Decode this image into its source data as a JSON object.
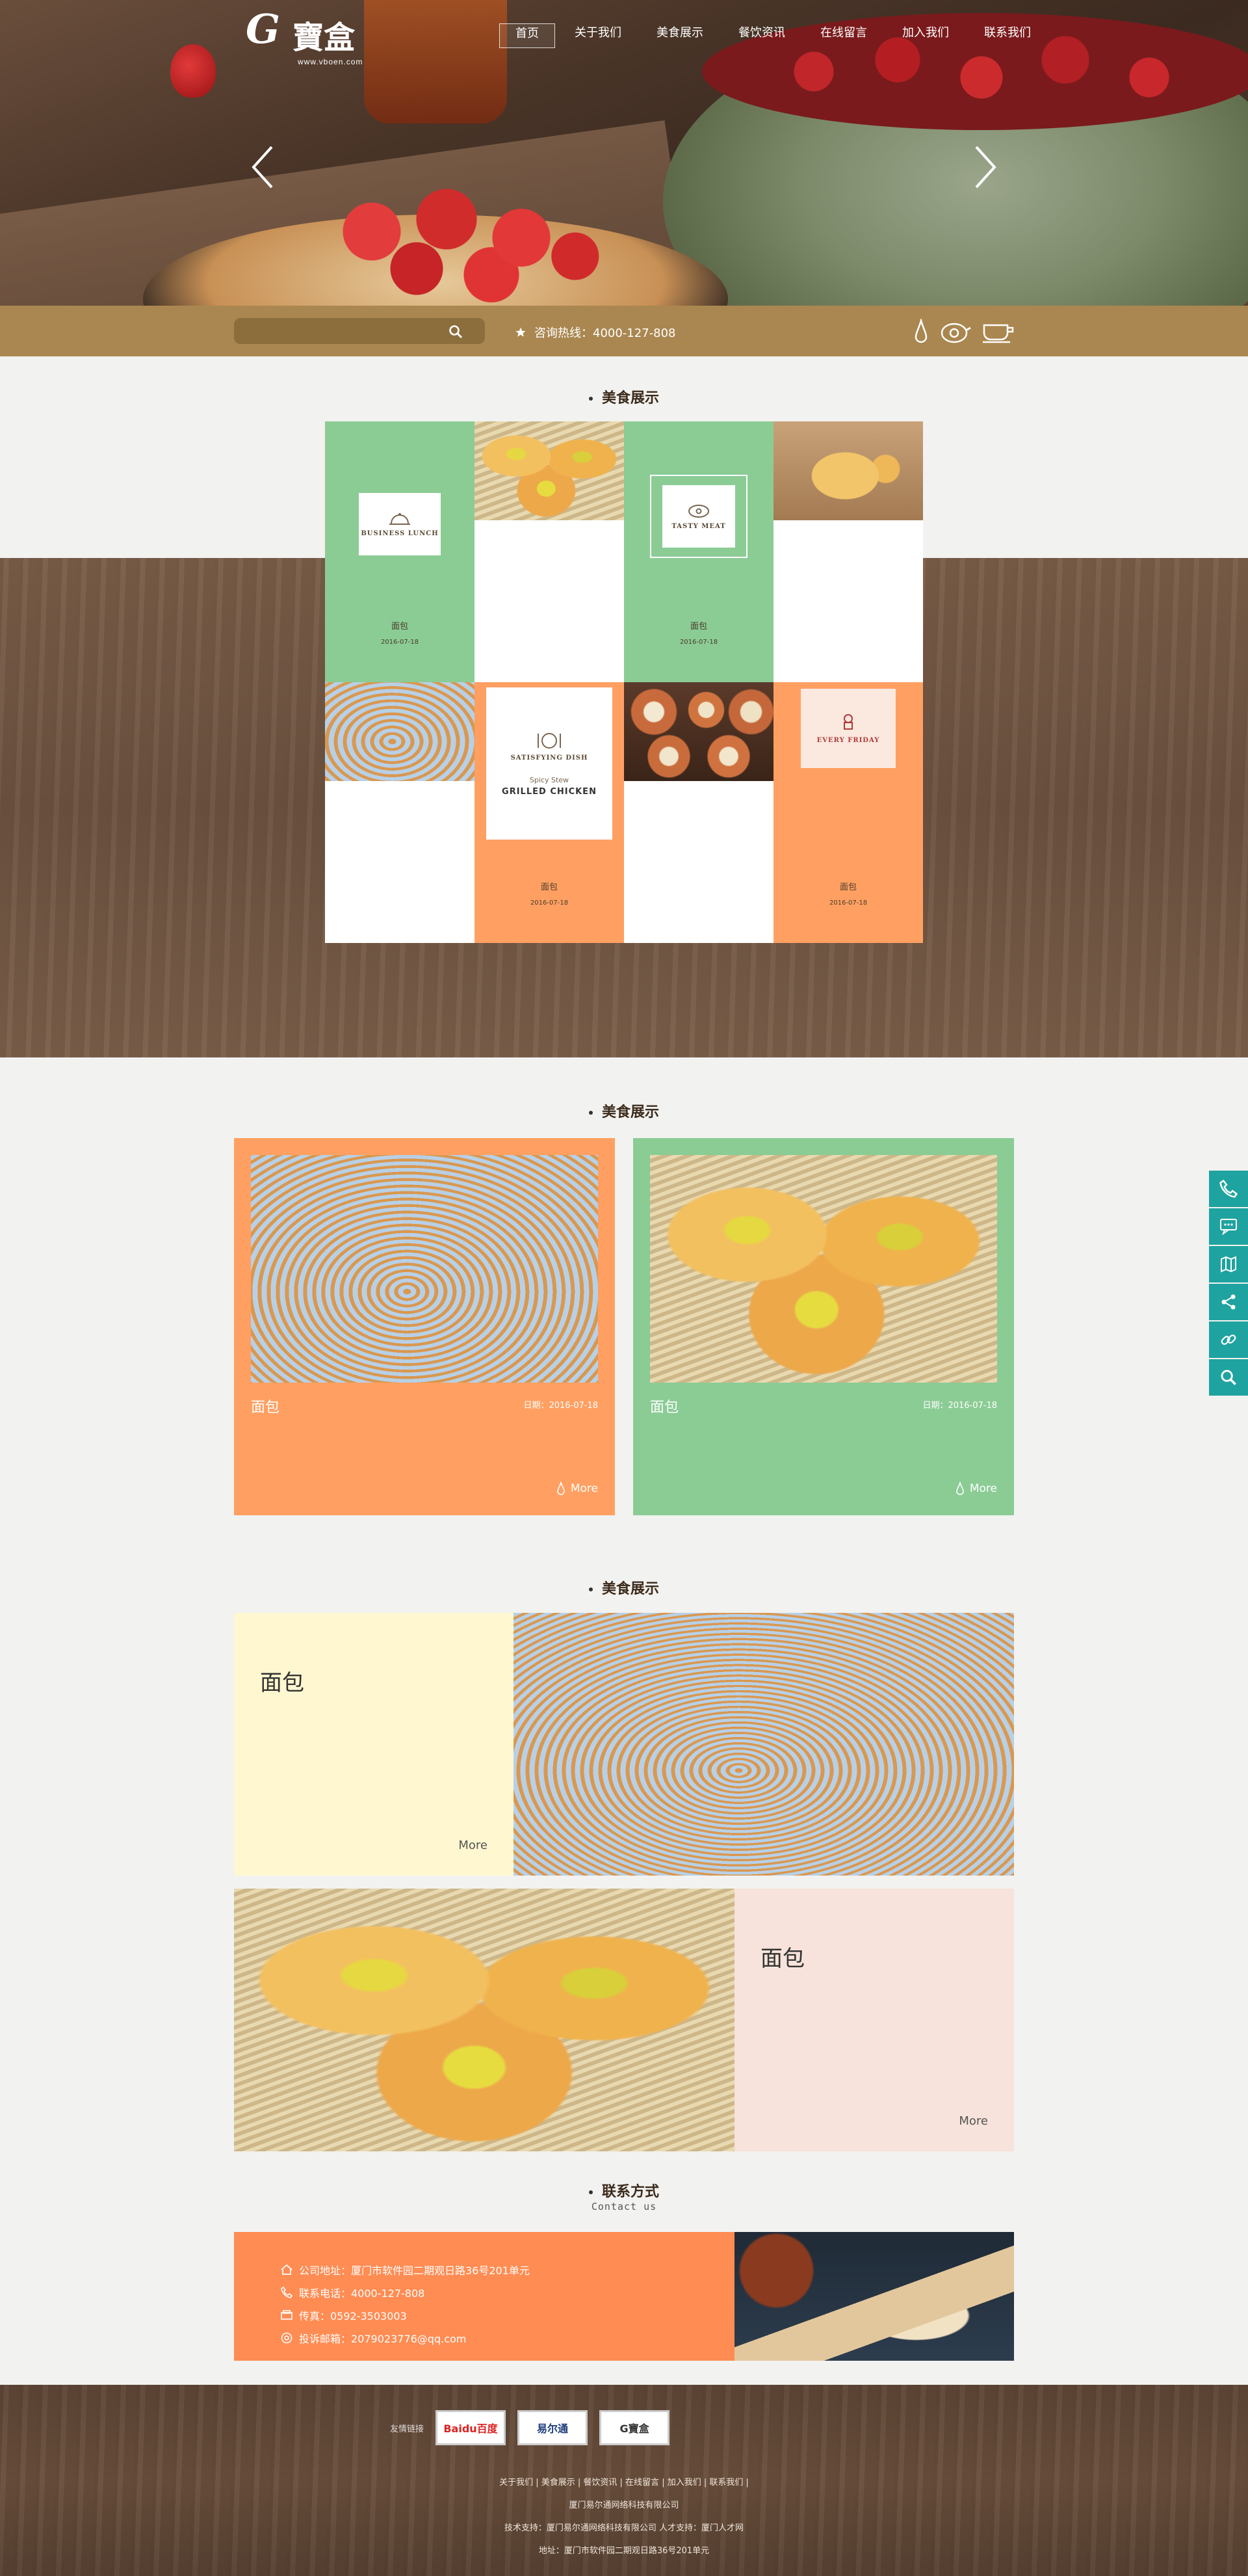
{
  "logo": {
    "g": "G",
    "han": "寶盒",
    "url": "www.vboen.com"
  },
  "nav": [
    {
      "label": "首页",
      "active": true
    },
    {
      "label": "关于我们"
    },
    {
      "label": "美食展示"
    },
    {
      "label": "餐饮资讯"
    },
    {
      "label": "在线留言"
    },
    {
      "label": "加入我们"
    },
    {
      "label": "联系我们"
    }
  ],
  "search": {
    "placeholder": ""
  },
  "hotline": "咨询热线：4000-127-808",
  "section1": {
    "title": "美食展示",
    "cards": [
      {
        "badge": "BUSINESS LUNCH",
        "label": "面包",
        "date": "2016-07-18"
      },
      {
        "badge": "TASTY MEAT",
        "label": "面包",
        "date": "2016-07-18"
      },
      {
        "badge": "SATISFYING DISH",
        "badge_sub1": "Spicy Stew",
        "badge_sub2": "GRILLED CHICKEN",
        "label": "面包",
        "date": "2016-07-18"
      },
      {
        "badge": "EVERY FRIDAY",
        "label": "面包",
        "date": "2016-07-18"
      }
    ]
  },
  "section2": {
    "title": "美食展示",
    "cards": [
      {
        "name": "面包",
        "date": "日期：2016-07-18",
        "more": "More",
        "color": "#ffa062"
      },
      {
        "name": "面包",
        "date": "日期：2016-07-18",
        "more": "More",
        "color": "#8bcc95"
      }
    ]
  },
  "section3": {
    "title": "美食展示",
    "rows": [
      {
        "title": "面包",
        "more": "More",
        "color": "#fff7d0"
      },
      {
        "title": "面包",
        "more": "More",
        "color": "#f7e3db"
      }
    ]
  },
  "contact": {
    "title": "联系方式",
    "subtitle": "Contact us",
    "address": "公司地址：厦门市软件园二期观日路36号201单元",
    "phone": "联系电话：4000-127-808",
    "fax": "传真：0592-3503003",
    "email": "投诉邮箱：2079023776@qq.com"
  },
  "footer": {
    "links_label": "友情链接",
    "link_logos": [
      "Baidu百度",
      "易尔通",
      "G寶盒"
    ],
    "nav_line": "关于我们 | 美食展示 | 餐饮资讯 | 在线留言 | 加入我们 | 联系我们 |",
    "company": "厦门易尔通网络科技有限公司",
    "support": "技术支持：厦门易尔通网络科技有限公司 人才支持：厦门人才网",
    "address": "地址：厦门市软件园二期观日路36号201单元"
  },
  "colors": {
    "gold": "#aa8750",
    "green": "#8bcc95",
    "orange": "#ffa062",
    "teal": "#1fa3a0",
    "contact": "#ff8c53"
  }
}
